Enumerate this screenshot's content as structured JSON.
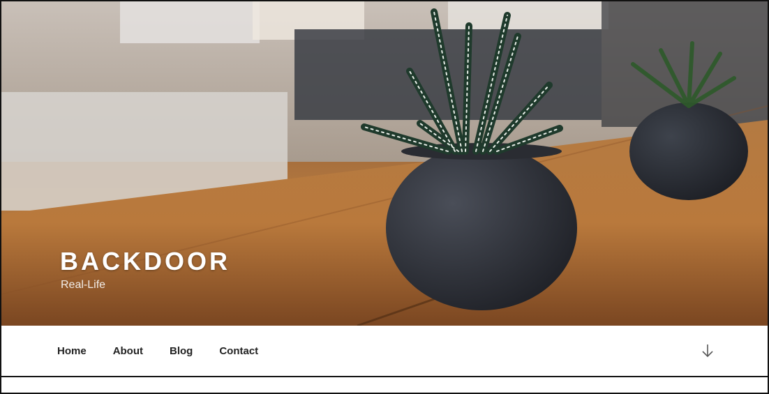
{
  "site": {
    "title": "BACKDOOR",
    "description": "Real-Life"
  },
  "nav": {
    "items": [
      {
        "label": "Home"
      },
      {
        "label": "About"
      },
      {
        "label": "Blog"
      },
      {
        "label": "Contact"
      }
    ],
    "scroll_icon": "arrow-down-icon"
  },
  "colors": {
    "nav_text": "#222222",
    "header_text": "#ffffff",
    "border": "#111111"
  }
}
